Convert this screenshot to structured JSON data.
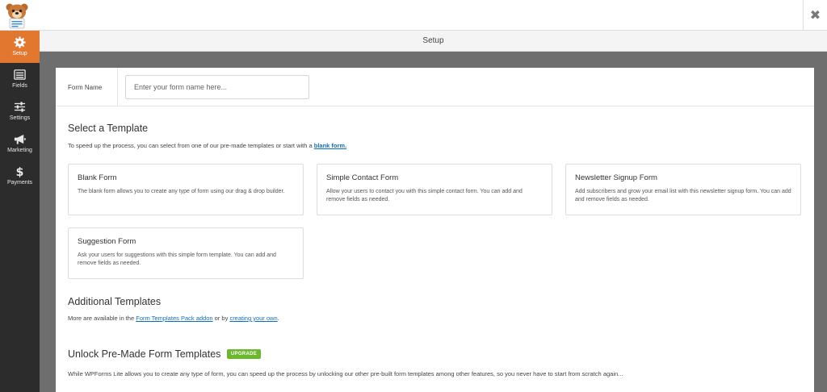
{
  "app": {
    "logo_icon": "wpforms-bear-logo",
    "close_icon": "close-icon",
    "accent": "#e27730"
  },
  "sidebar": {
    "items": [
      {
        "label": "Setup",
        "icon": "gear-icon",
        "active": true
      },
      {
        "label": "Fields",
        "icon": "list-icon",
        "active": false
      },
      {
        "label": "Settings",
        "icon": "sliders-icon",
        "active": false
      },
      {
        "label": "Marketing",
        "icon": "megaphone-icon",
        "active": false
      },
      {
        "label": "Payments",
        "icon": "dollar-icon",
        "active": false
      }
    ]
  },
  "header": {
    "title": "Setup"
  },
  "form_name": {
    "label": "Form Name",
    "placeholder": "Enter your form name here...",
    "value": ""
  },
  "select_template": {
    "heading": "Select a Template",
    "intro": "To speed up the process, you can select from one of our pre-made templates or start with a",
    "intro_link": "blank form.",
    "templates": [
      {
        "title": "Blank Form",
        "description": "The blank form allows you to create any type of form using our drag & drop builder."
      },
      {
        "title": "Simple Contact Form",
        "description": "Allow your users to contact you with this simple contact form. You can add and remove fields as needed."
      },
      {
        "title": "Newsletter Signup Form",
        "description": "Add subscribers and grow your email list with this newsletter signup form. You can add and remove fields as needed."
      },
      {
        "title": "Suggestion Form",
        "description": "Ask your users for suggestions with this simple form template. You can add and remove fields as needed."
      }
    ]
  },
  "additional_templates": {
    "heading": "Additional Templates",
    "text_before": "More are available in the",
    "addon_link": "Form Templates Pack addon",
    "text_middle": "or by",
    "own_link": "creating your own",
    "text_after": "."
  },
  "unlock": {
    "heading": "Unlock Pre-Made Form Templates",
    "badge": "UPGRADE",
    "badge_color": "#6bb82f",
    "text": "While WPForms Lite allows you to create any type of form, you can speed up the process by unlocking our other pre-built form templates among other features, so you never have to start from scratch again..."
  }
}
